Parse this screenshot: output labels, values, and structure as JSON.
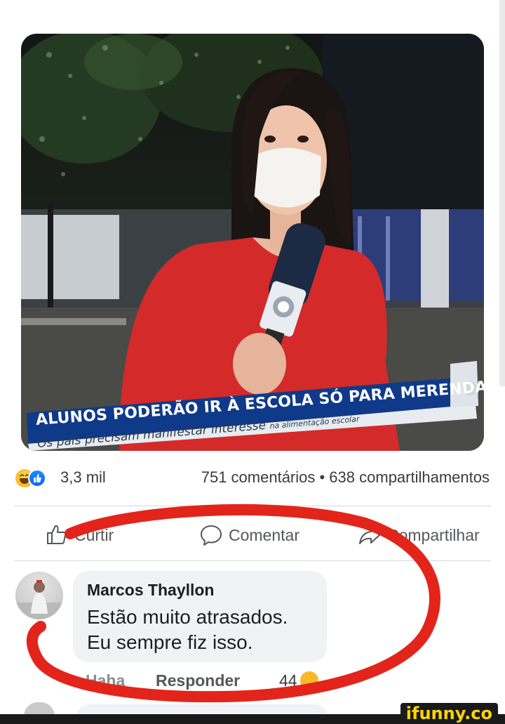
{
  "post": {
    "image": {
      "headline": "ALUNOS PODERÃO IR À ESCOLA SÓ PARA MERENDAR",
      "subline_main": "Os pais precisam manifestar interesse",
      "subline_small": "na alimentação escolar"
    },
    "reactions": {
      "icons": [
        "haha-emoji-icon",
        "like-emoji-icon"
      ],
      "count": "3,3 mil",
      "comments_shares": "751 comentários • 638 compartilhamentos"
    },
    "actions": {
      "like": "Curtir",
      "comment": "Comentar",
      "share": "Compartilhar"
    }
  },
  "comment": {
    "author": "Marcos Thayllon",
    "text": "Estão muito atrasados.\nEu sempre fiz isso.",
    "haha_label": "Haha",
    "reply_label": "Responder",
    "reaction_count": "44"
  },
  "colors": {
    "annotation_red": "#e3241b",
    "facebook_blue": "#0866ff",
    "haha_yellow": "#f7b928",
    "news_blue": "#0f3a8a",
    "dress_red": "#d42a2a"
  },
  "watermark": "ifunny.co"
}
